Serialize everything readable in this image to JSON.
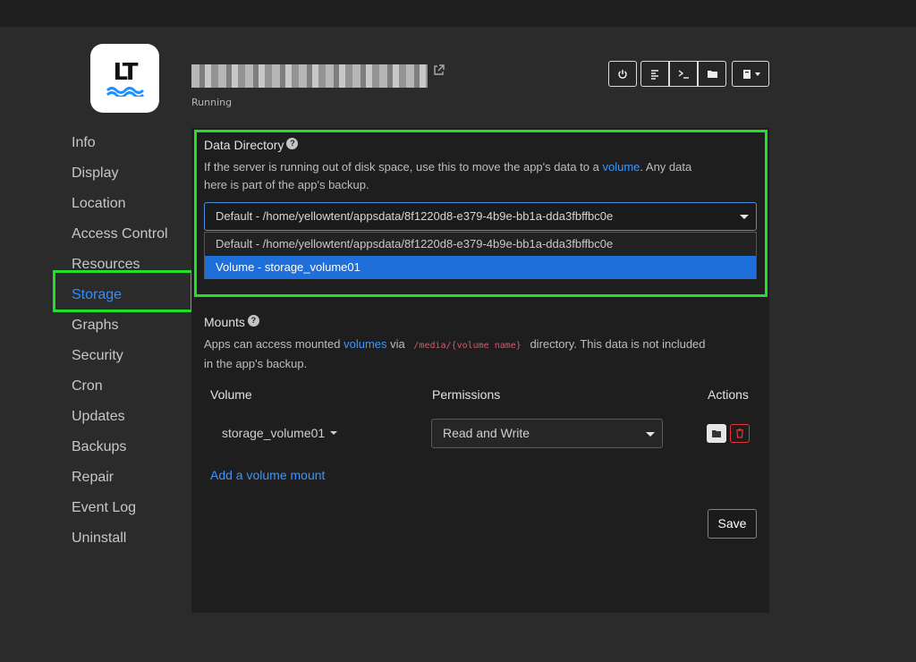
{
  "header": {
    "app_icon_text": "LT",
    "status": "Running"
  },
  "toolbar": {
    "icons": [
      "power-icon",
      "logs-icon",
      "terminal-icon",
      "folder-icon",
      "book-icon"
    ]
  },
  "sidebar": {
    "items": [
      {
        "label": "Info"
      },
      {
        "label": "Display"
      },
      {
        "label": "Location"
      },
      {
        "label": "Access Control"
      },
      {
        "label": "Resources"
      },
      {
        "label": "Storage",
        "active": true
      },
      {
        "label": "Graphs"
      },
      {
        "label": "Security"
      },
      {
        "label": "Cron"
      },
      {
        "label": "Updates"
      },
      {
        "label": "Backups"
      },
      {
        "label": "Repair"
      },
      {
        "label": "Event Log"
      },
      {
        "label": "Uninstall"
      }
    ]
  },
  "data_directory": {
    "title": "Data Directory",
    "desc_1": "If the server is running out of disk space, use this to move the app's data to a",
    "desc_link": "volume",
    "desc_2": ". Any data",
    "desc_3": "here is part of the app's backup.",
    "selected": "Default - /home/yellowtent/appsdata/8f1220d8-e379-4b9e-bb1a-dda3fbffbc0e",
    "options": [
      "Default - /home/yellowtent/appsdata/8f1220d8-e379-4b9e-bb1a-dda3fbffbc0e",
      "Volume - storage_volume01"
    ],
    "highlighted_option": "Volume - storage_volume01"
  },
  "mounts": {
    "title": "Mounts",
    "desc_1": "Apps can access mounted",
    "desc_link": "volumes",
    "desc_2": "via",
    "desc_code": "/media/{volume name}",
    "desc_3": "directory. This data is not included",
    "desc_4": "in the app's backup.",
    "columns": [
      "Volume",
      "Permissions",
      "Actions"
    ],
    "rows": [
      {
        "volume": "storage_volume01",
        "permission": "Read and Write"
      }
    ],
    "add_label": "Add a volume mount",
    "save_label": "Save"
  },
  "colors": {
    "accent": "#3d95ff",
    "highlight": "#21e02a",
    "selected_option": "#1e6fd9",
    "danger": "#e0353f"
  }
}
